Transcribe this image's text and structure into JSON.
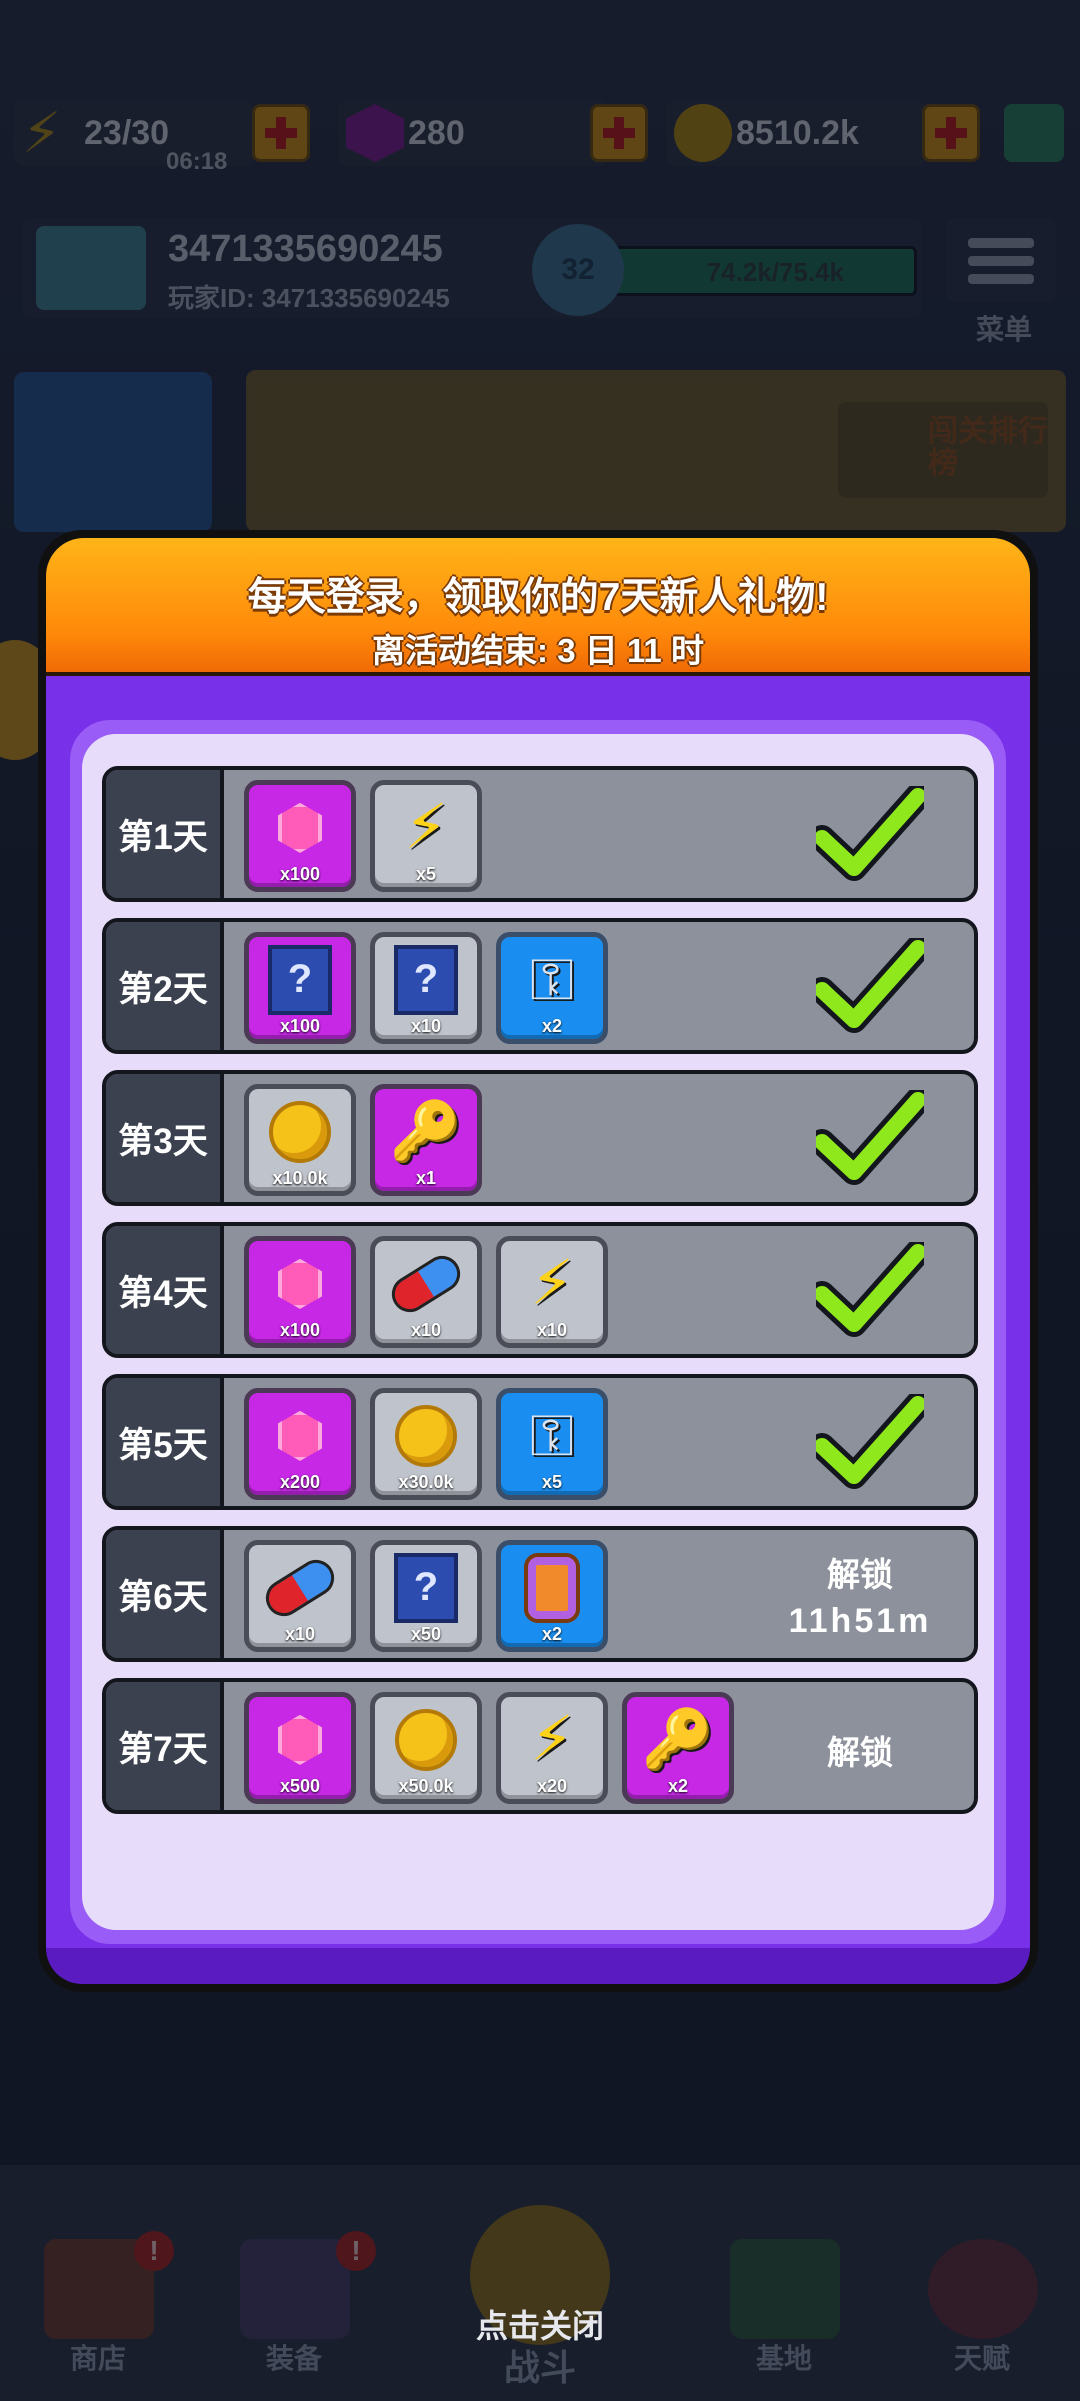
{
  "resources": {
    "energy": "23/30",
    "energy_timer": "06:18",
    "gems": "280",
    "coins": "8510.2k"
  },
  "profile": {
    "name": "3471335690245",
    "player_id": "玩家ID: 3471335690245",
    "level": "32",
    "xp": "74.2k/75.4k",
    "menu_label": "菜单"
  },
  "banner": {
    "tag": "闯关排行榜"
  },
  "modal": {
    "title": "每天登录，领取你的7天新人礼物!",
    "subtitle": "离活动结束: 3 日 11 时"
  },
  "days": [
    {
      "label": "第1天",
      "items": [
        {
          "icon": "gem-icon",
          "bg": "purple",
          "qty": "x100"
        },
        {
          "icon": "energy-bolt-icon",
          "bg": "grey",
          "qty": "x5"
        }
      ],
      "status": "claimed"
    },
    {
      "label": "第2天",
      "items": [
        {
          "icon": "mystery-card-icon",
          "bg": "purple",
          "qty": "x100"
        },
        {
          "icon": "mystery-card-icon",
          "bg": "grey",
          "qty": "x10"
        },
        {
          "icon": "silver-key-icon",
          "bg": "blue",
          "qty": "x2"
        }
      ],
      "status": "claimed"
    },
    {
      "label": "第3天",
      "items": [
        {
          "icon": "coin-icon",
          "bg": "grey",
          "qty": "x10.0k"
        },
        {
          "icon": "gold-key-icon",
          "bg": "purple",
          "qty": "x1"
        }
      ],
      "status": "claimed"
    },
    {
      "label": "第4天",
      "items": [
        {
          "icon": "gem-icon",
          "bg": "purple",
          "qty": "x100"
        },
        {
          "icon": "pill-icon",
          "bg": "grey",
          "qty": "x10"
        },
        {
          "icon": "energy-bolt-icon",
          "bg": "grey",
          "qty": "x10"
        }
      ],
      "status": "claimed"
    },
    {
      "label": "第5天",
      "items": [
        {
          "icon": "gem-icon",
          "bg": "purple",
          "qty": "x200"
        },
        {
          "icon": "coin-icon",
          "bg": "grey",
          "qty": "x30.0k"
        },
        {
          "icon": "silver-key-icon",
          "bg": "blue",
          "qty": "x5"
        }
      ],
      "status": "claimed"
    },
    {
      "label": "第6天",
      "items": [
        {
          "icon": "pill-icon",
          "bg": "grey",
          "qty": "x10"
        },
        {
          "icon": "mystery-card-icon",
          "bg": "grey",
          "qty": "x50"
        },
        {
          "icon": "potion-jar-icon",
          "bg": "blue",
          "qty": "x2"
        }
      ],
      "status": "locked",
      "lock_text": "解锁",
      "countdown": "11h51m"
    },
    {
      "label": "第7天",
      "items": [
        {
          "icon": "gem-icon",
          "bg": "purple",
          "qty": "x500"
        },
        {
          "icon": "coin-icon",
          "bg": "grey",
          "qty": "x50.0k"
        },
        {
          "icon": "energy-bolt-icon",
          "bg": "grey",
          "qty": "x20"
        },
        {
          "icon": "gold-key-icon",
          "bg": "purple",
          "qty": "x2"
        }
      ],
      "status": "locked",
      "lock_text": "解锁"
    }
  ],
  "bottom_nav": [
    {
      "label": "商店",
      "badge": "!"
    },
    {
      "label": "装备",
      "badge": "!"
    },
    {
      "label": "战斗",
      "hint": "点击关闭"
    },
    {
      "label": "基地"
    },
    {
      "label": "天赋"
    }
  ],
  "colors": {
    "claimed_check": "#8ee81c",
    "header_orange": "#ff9a10",
    "modal_purple": "#7830e8"
  }
}
